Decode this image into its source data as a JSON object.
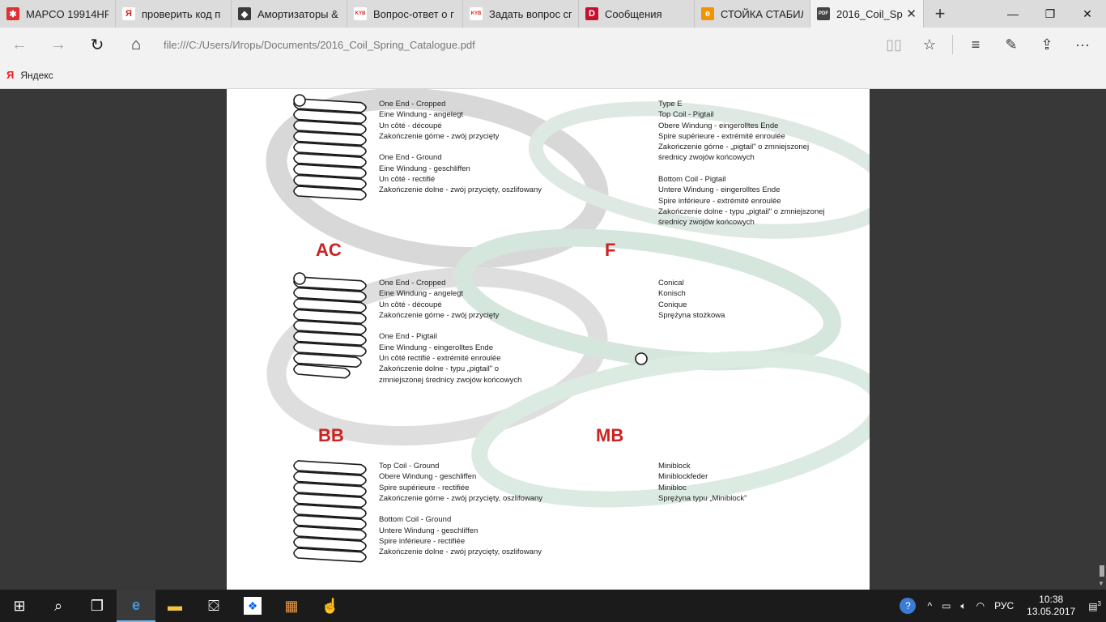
{
  "tabs": [
    {
      "title": "MAPCO 19914HP",
      "icon": "mapco-icon",
      "color": "#e03030",
      "glyph": "✱"
    },
    {
      "title": "проверить код п",
      "icon": "yandex-icon",
      "color": "#ffffff",
      "glyph": "Я"
    },
    {
      "title": "Амортизаторы &",
      "icon": "shield-site-icon",
      "color": "#3a3a3a",
      "glyph": "◆"
    },
    {
      "title": "Вопрос-ответ о г",
      "icon": "kyb-icon",
      "color": "#ffffff",
      "glyph": "KYB"
    },
    {
      "title": "Задать вопрос сг",
      "icon": "kyb-icon",
      "color": "#ffffff",
      "glyph": "KYB"
    },
    {
      "title": "Сообщения",
      "icon": "drom-icon",
      "color": "#c8102e",
      "glyph": "D"
    },
    {
      "title": "СТОЙКА СТАБИЛ",
      "icon": "exist-icon",
      "color": "#f29400",
      "glyph": "e"
    },
    {
      "title": "2016_Coil_Spr",
      "icon": "pdf-icon",
      "color": "#444444",
      "glyph": "PDF"
    }
  ],
  "address": {
    "url": "file:///C:/Users/Игорь/Documents/2016_Coil_Spring_Catalogue.pdf"
  },
  "favorites": {
    "yandex": "Яндекс",
    "yandex_glyph": "Я"
  },
  "pdf": {
    "codes": {
      "ac": "AC",
      "f": "F",
      "bb": "BB",
      "mb": "MB"
    },
    "block1": [
      "One End - Cropped",
      "Eine Windung - angelegt",
      "Un côté - découpé",
      "Zakończenie górne - zwój przycięty"
    ],
    "block2": [
      "One End - Ground",
      "Eine Windung - geschliffen",
      "Un côté - rectifié",
      "Zakończenie dolne - zwój przycięty, oszlifowany"
    ],
    "block3": [
      "Type E",
      "Top Coil - Pigtail",
      "Obere Windung - eingerolltes Ende",
      "Spire supérieure  - extrémité enroulée",
      "Zakończenie górne - „pigtail\" o zmniejszonej",
      "średnicy zwojów końcowych"
    ],
    "block4": [
      "Bottom Coil - Pigtail",
      "Untere Windung - eingerolltes Ende",
      "Spire inférieure - extrémité enroulée",
      "Zakończenie dolne - typu „pigtail\" o zmniejszonej",
      "średnicy zwojów końcowych"
    ],
    "block5": [
      "One End - Cropped",
      "Eine Windung - angelegt",
      "Un côté  - découpé",
      "Zakończenie górne - zwój przycięty"
    ],
    "block6": [
      "One End - Pigtail",
      "Eine Windung - eingerolltes Ende",
      "Un côté rectifié - extrémité enroulée",
      "Zakończenie dolne - typu „pigtail\" o",
      "zmniejszonej średnicy zwojów końcowych"
    ],
    "block7": [
      "Conical",
      "Konisch",
      "Conique",
      "Sprężyna stożkowa"
    ],
    "block8": [
      "Top Coil - Ground",
      "Obere Windung - geschliffen",
      "Spire supérieure  - rectifiée",
      "Zakończenie górne - zwój przycięty, oszlifowany"
    ],
    "block9": [
      "Bottom Coil - Ground",
      "Untere Windung - geschliffen",
      "Spire inférieure - rectifiée",
      "Zakończenie dolne - zwój przycięty, oszlifowany"
    ],
    "block10": [
      "Miniblock",
      "Miniblockfeder",
      "Minibloc",
      "Sprężyna typu „Miniblock\""
    ],
    "watermark": "KYB"
  },
  "tray": {
    "language": "РУС",
    "time": "10:38",
    "date": "13.05.2017",
    "notifications": "3"
  },
  "colors": {
    "accent": "#cc2222",
    "tab_bg": "#dcdcdc",
    "chrome_bg": "#f2f2f2",
    "taskbar": "#1b1b1b"
  }
}
